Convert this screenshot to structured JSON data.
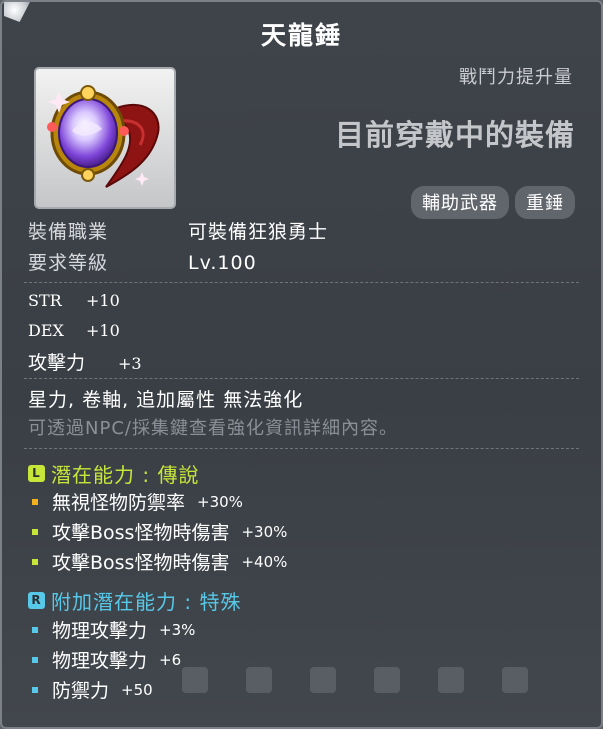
{
  "item": {
    "name": "天龍錘",
    "power_label": "戰鬥力提升量",
    "status": "目前穿戴中的裝備",
    "categories": [
      "輔助武器",
      "重錘"
    ]
  },
  "requirements": [
    {
      "label": "裝備職業",
      "value": "可裝備狂狼勇士"
    },
    {
      "label": "要求等級",
      "value": "Lv.100"
    }
  ],
  "stats": [
    {
      "name": "STR",
      "value": "+10"
    },
    {
      "name": "DEX",
      "value": "+10"
    },
    {
      "name": "攻擊力",
      "value": "+3"
    }
  ],
  "notes": {
    "restriction": "星力, 卷軸, 追加屬性 無法強化",
    "hint": "可透過NPC/採集鍵查看強化資訊詳細內容。"
  },
  "potential": {
    "icon_letter": "L",
    "header": "潛在能力 : 傳說",
    "color": "#c8e63a",
    "lines": [
      {
        "text": "無視怪物防禦率",
        "value": "+30%"
      },
      {
        "text": "攻擊Boss怪物時傷害",
        "value": "+30%"
      },
      {
        "text": "攻擊Boss怪物時傷害",
        "value": "+40%"
      }
    ]
  },
  "additional_potential": {
    "icon_letter": "R",
    "header": "附加潛在能力 : 特殊",
    "color": "#58c8e8",
    "lines": [
      {
        "text": "物理攻擊力",
        "value": "+3%"
      },
      {
        "text": "物理攻擊力",
        "value": "+6"
      },
      {
        "text": "防禦力",
        "value": "+50"
      }
    ]
  }
}
